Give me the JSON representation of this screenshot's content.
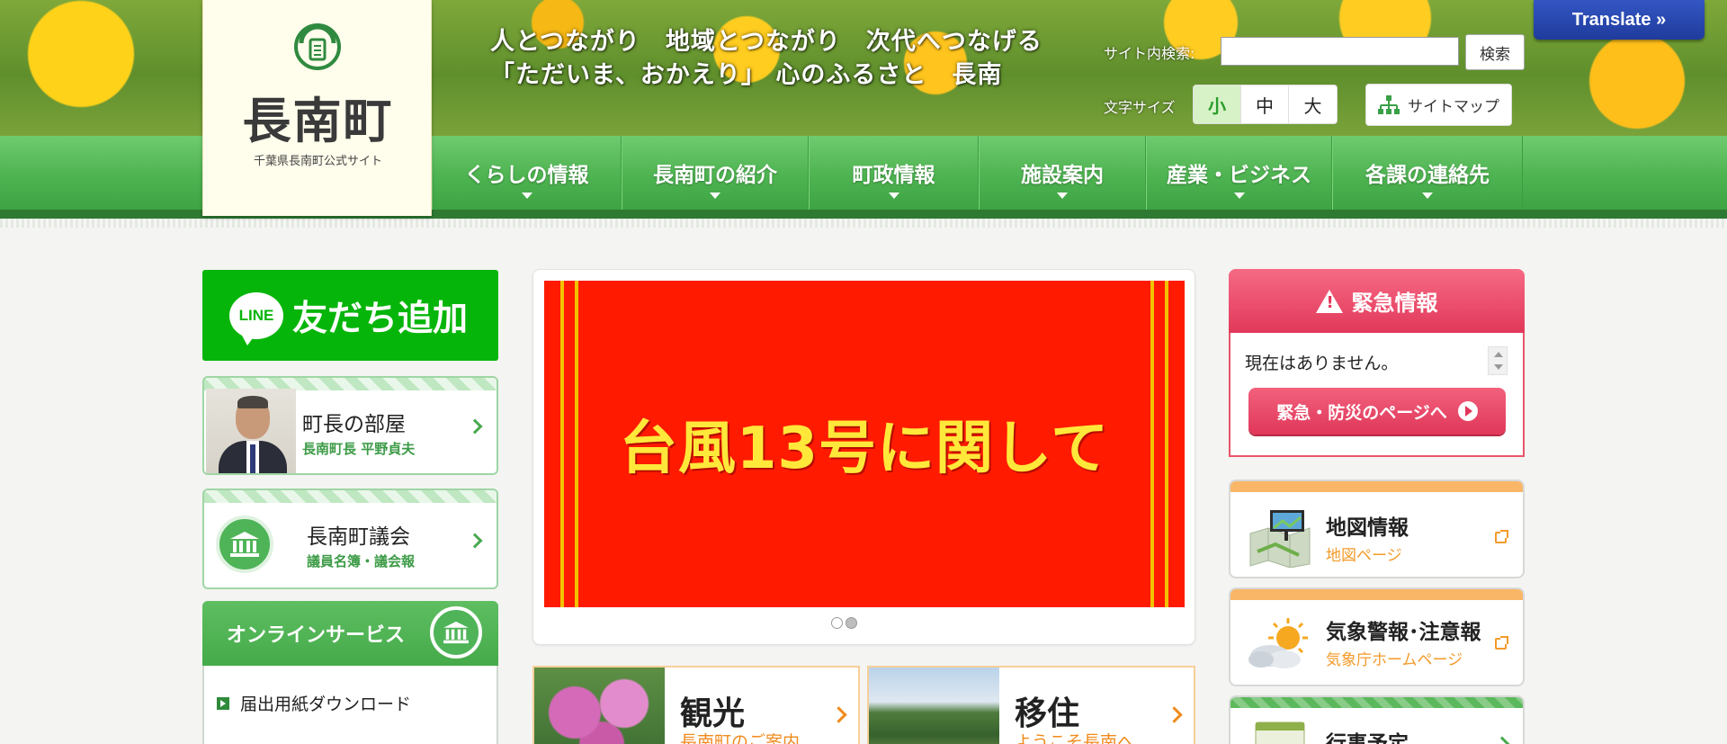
{
  "header": {
    "tagline": [
      "人とつながり　地域とつながり　次代へつなげる",
      "「ただいま、おかえり」 心のふるさと　長南"
    ],
    "search_label": "サイト内検索:",
    "search_value": "",
    "search_button": "検索",
    "fontsize_label": "文字サイズ",
    "fontsize_options": [
      "小",
      "中",
      "大"
    ],
    "fontsize_selected": "小",
    "sitemap_label": "サイトマップ",
    "translate_label": "Translate »"
  },
  "logo": {
    "title": "長南町",
    "subtitle": "千葉県長南町公式サイト"
  },
  "nav": {
    "items": [
      "くらしの情報",
      "長南町の紹介",
      "町政情報",
      "施設案内",
      "産業・ビジネス",
      "各課の連絡先"
    ]
  },
  "left": {
    "line_badge": "LINE",
    "line_text": "友だち追加",
    "mayor": {
      "title": "町長の部屋",
      "sub": "長南町長 平野貞夫"
    },
    "council": {
      "title": "長南町議会",
      "sub": "議員名簿・議会報"
    },
    "online": {
      "title": "オンラインサービス",
      "items": [
        "届出用紙ダウンロード"
      ]
    }
  },
  "center": {
    "slide_text": "台風13号に関して",
    "slide_count": 2,
    "slide_active": 1,
    "tiles": [
      {
        "title": "観光",
        "sub": "長南町のご案内"
      },
      {
        "title": "移住",
        "sub": "ようこそ長南へ"
      }
    ]
  },
  "right": {
    "emergency": {
      "title": "緊急情報",
      "message": "現在はありません。",
      "button": "緊急・防災のページへ"
    },
    "cards": [
      {
        "title": "地図情報",
        "sub": "地図ページ"
      },
      {
        "title": "気象警報･注意報",
        "sub": "気象庁ホームページ"
      },
      {
        "title": "行事予定",
        "sub": ""
      }
    ]
  },
  "colors": {
    "nav_green": "#4eb351",
    "line_green": "#06b50a",
    "emergency_red": "#e2385a",
    "accent_orange": "#f08a1c",
    "translate_blue": "#2a47b0"
  }
}
